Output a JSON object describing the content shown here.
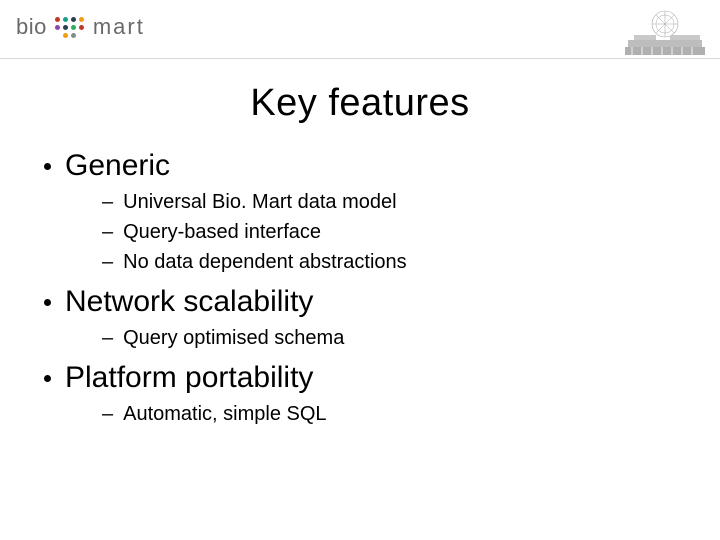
{
  "logo": {
    "part1": "bio",
    "part2": "mart"
  },
  "title": "Key features",
  "sections": [
    {
      "heading": "Generic",
      "items": [
        "Universal Bio. Mart data model",
        "Query-based interface",
        "No data dependent abstractions"
      ]
    },
    {
      "heading": "Network scalability",
      "items": [
        "Query optimised schema"
      ]
    },
    {
      "heading": "Platform portability",
      "items": [
        "Automatic, simple SQL"
      ]
    }
  ]
}
